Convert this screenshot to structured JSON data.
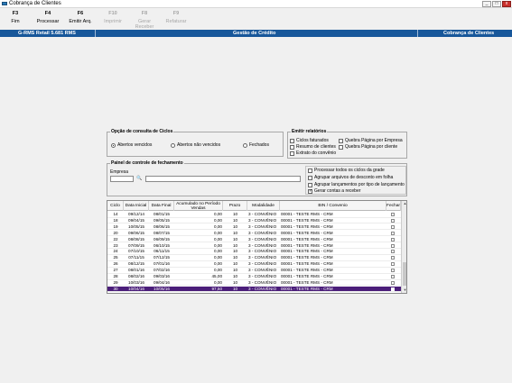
{
  "window": {
    "title": "Cobrança de Clientes",
    "min": "_",
    "max": "□",
    "close": "x"
  },
  "toolbar": [
    {
      "key": "F3",
      "label": "Fim",
      "enabled": true
    },
    {
      "key": "F4",
      "label": "Processar",
      "enabled": true
    },
    {
      "key": "F6",
      "label": "Emitir Arq.",
      "enabled": true
    },
    {
      "key": "F10",
      "label": "Imprimir",
      "enabled": false
    },
    {
      "key": "F8",
      "label": "Gerar Receber",
      "enabled": false
    },
    {
      "key": "F9",
      "label": "Refaturar",
      "enabled": false
    }
  ],
  "header": {
    "left": "G-RMS Retail 5.681 RMS",
    "center": "Gestão de Crédito",
    "right": "Cobrança de Clientes"
  },
  "ciclos": {
    "title": "Opção de consulta de Ciclos",
    "options": [
      "Abertos vencidos",
      "Abertos não vencidos",
      "Fechados"
    ],
    "selected": "Abertos vencidos"
  },
  "relatorios": {
    "title": "Emitir relatórios",
    "items": [
      "Ciclos faturados",
      "Resumo de clientes",
      "Extrato do convênio",
      "Quebra Página por Empresa",
      "Quebra Página por cliente"
    ]
  },
  "painel": {
    "title": "Painel de controle de fechamento",
    "empresa_label": "Empresa",
    "empresa_value": "",
    "empresa_name": "",
    "search": "🔍",
    "checks": [
      {
        "label": "Processar todos os ciclos da grade",
        "checked": false
      },
      {
        "label": "Agrupar arquivos de desconto em folha",
        "checked": false
      },
      {
        "label": "Agrupar lançamentos por tipo de lançamento",
        "checked": false
      },
      {
        "label": "Gerar contas a receber",
        "checked": true
      }
    ]
  },
  "grid": {
    "columns": [
      "Ciclo",
      "Data Inicial",
      "Data Final",
      "Acumulado no Período Vendas",
      "Prazo",
      "Modalidade",
      "BIN / Convenio",
      "Fechar"
    ],
    "rows": [
      [
        "14",
        "09/12/14",
        "08/01/15",
        "0,00",
        "10",
        "3 - CONVÊNIO",
        "00001 - TESTE RMS - CRM"
      ],
      [
        "18",
        "09/04/15",
        "09/05/15",
        "0,00",
        "10",
        "3 - CONVÊNIO",
        "00001 - TESTE RMS - CRM"
      ],
      [
        "19",
        "10/05/15",
        "08/06/15",
        "0,00",
        "10",
        "3 - CONVÊNIO",
        "00001 - TESTE RMS - CRM"
      ],
      [
        "20",
        "09/06/15",
        "08/07/15",
        "0,00",
        "10",
        "3 - CONVÊNIO",
        "00001 - TESTE RMS - CRM"
      ],
      [
        "22",
        "08/08/15",
        "06/09/15",
        "0,00",
        "10",
        "3 - CONVÊNIO",
        "00001 - TESTE RMS - CRM"
      ],
      [
        "23",
        "07/09/15",
        "06/10/15",
        "0,00",
        "10",
        "3 - CONVÊNIO",
        "00001 - TESTE RMS - CRM"
      ],
      [
        "24",
        "07/10/15",
        "06/11/15",
        "0,00",
        "10",
        "3 - CONVÊNIO",
        "00001 - TESTE RMS - CRM"
      ],
      [
        "25",
        "07/11/15",
        "07/12/15",
        "0,00",
        "10",
        "3 - CONVÊNIO",
        "00001 - TESTE RMS - CRM"
      ],
      [
        "26",
        "08/12/15",
        "07/01/16",
        "0,00",
        "10",
        "3 - CONVÊNIO",
        "00001 - TESTE RMS - CRM"
      ],
      [
        "27",
        "08/01/16",
        "07/02/16",
        "0,00",
        "10",
        "3 - CONVÊNIO",
        "00001 - TESTE RMS - CRM"
      ],
      [
        "28",
        "08/02/16",
        "09/03/16",
        "45,00",
        "10",
        "3 - CONVÊNIO",
        "00001 - TESTE RMS - CRM"
      ],
      [
        "29",
        "10/03/16",
        "09/04/16",
        "0,00",
        "10",
        "3 - CONVÊNIO",
        "00001 - TESTE RMS - CRM"
      ],
      [
        "30",
        "10/04/16",
        "10/05/16",
        "97,50",
        "10",
        "3 - CONVÊNIO",
        "00001 - TESTE RMS - CRM"
      ]
    ],
    "selected_row": 12
  },
  "colors": {
    "header_blue": "#17579a",
    "selection": "#4b1e7a"
  }
}
